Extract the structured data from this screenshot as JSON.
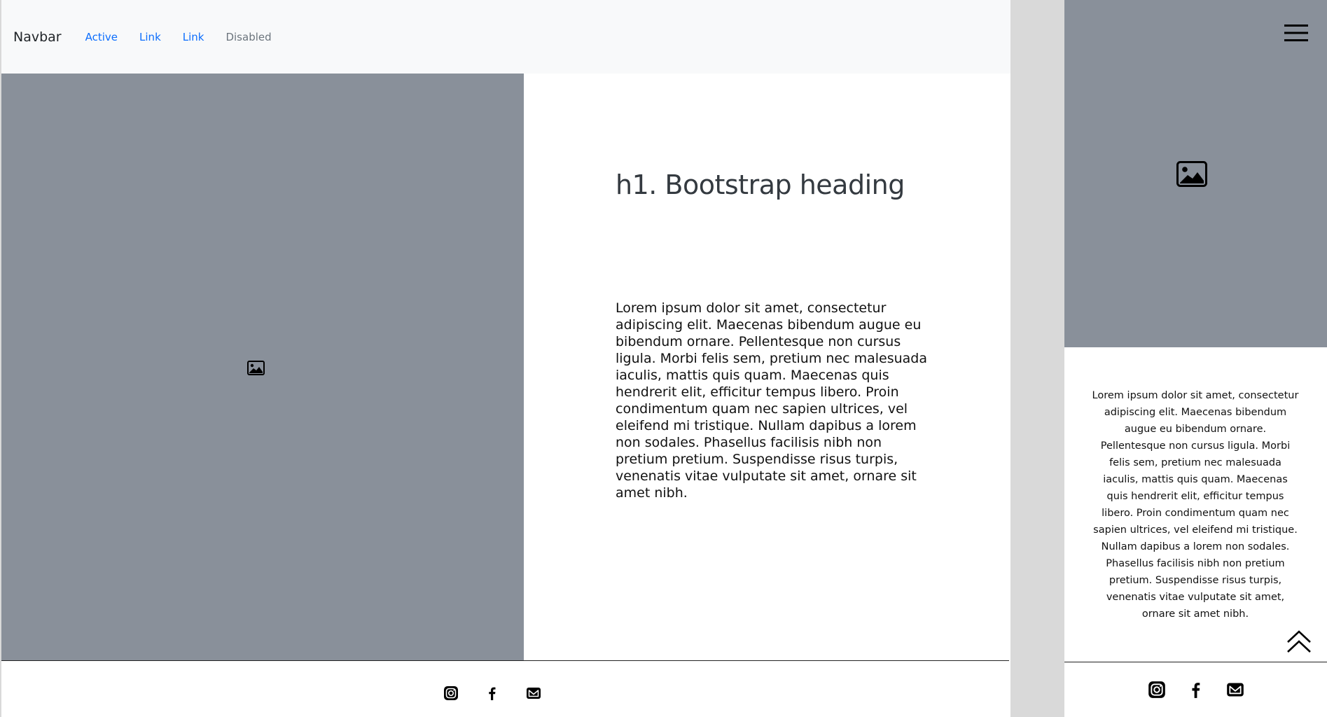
{
  "desktop": {
    "navbar": {
      "brand": "Navbar",
      "links": [
        {
          "label": "Active"
        },
        {
          "label": "Link"
        },
        {
          "label": "Link"
        },
        {
          "label": "Disabled"
        }
      ]
    },
    "hero_image_icon": "image-icon",
    "heading": "h1. Bootstrap heading",
    "body_text": "Lorem ipsum dolor sit amet, consectetur adipiscing elit. Maecenas bibendum augue eu bibendum ornare. Pellentesque non cursus ligula. Morbi felis sem, pretium nec malesuada iaculis, mattis quis quam. Maecenas quis hendrerit elit, efficitur tempus libero. Proin condimentum quam nec sapien ultrices, vel eleifend mi tristique. Nullam dapibus a lorem non sodales. Phasellus facilisis nibh non pretium pretium. Suspendisse risus turpis, venenatis vitae vulputate sit amet, ornare sit amet nibh.",
    "footer_icons": [
      "instagram-icon",
      "facebook-icon",
      "email-icon"
    ]
  },
  "mobile": {
    "menu_icon": "hamburger-menu-icon",
    "hero_image_icon": "image-icon",
    "body_text": "Lorem ipsum dolor sit amet, consectetur adipiscing elit. Maecenas bibendum augue eu bibendum ornare. Pellentesque non cursus ligula. Morbi felis sem, pretium nec malesuada iaculis, mattis quis quam. Maecenas quis hendrerit elit, efficitur tempus libero. Proin condimentum quam nec sapien ultrices, vel eleifend mi tristique. Nullam dapibus a lorem non sodales. Phasellus facilisis nibh non pretium pretium. Suspendisse risus turpis, venenatis vitae vulputate sit amet, ornare sit amet nibh.",
    "back_to_top_icon": "double-chevron-up-icon",
    "footer_icons": [
      "instagram-icon",
      "facebook-icon",
      "email-icon"
    ]
  },
  "colors": {
    "placeholder_gray": "#89909a",
    "navbar_bg": "#f8f9fa",
    "link_blue": "#0d6efd",
    "disabled_gray": "#6c757d",
    "canvas_gray": "#d9d9d9"
  }
}
